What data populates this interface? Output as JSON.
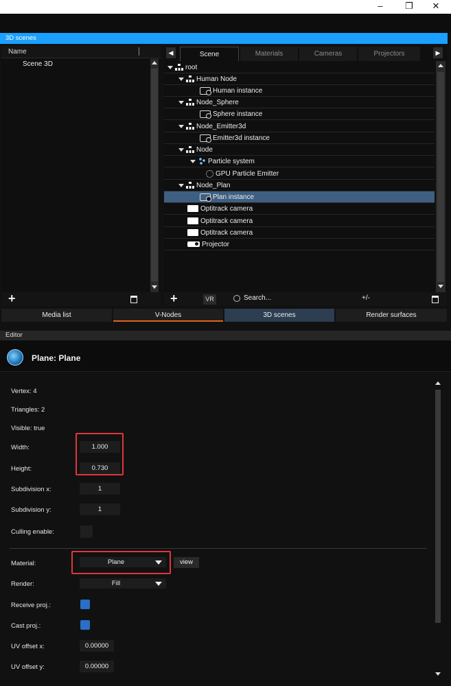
{
  "window": {
    "minimize": "–",
    "restore": "❐",
    "close": "✕"
  },
  "scenes_panel": {
    "title": "3D scenes",
    "name_header": "Name",
    "items": [
      "Scene 3D"
    ]
  },
  "tabs": [
    "Scene",
    "Materials",
    "Cameras",
    "Projectors"
  ],
  "tree": [
    {
      "label": "root",
      "icon": "node-icon"
    },
    {
      "label": "Human Node",
      "icon": "node-icon"
    },
    {
      "label": "Human instance",
      "icon": "instance-icon"
    },
    {
      "label": "Node_Sphere",
      "icon": "node-icon"
    },
    {
      "label": "Sphere instance",
      "icon": "instance-icon"
    },
    {
      "label": "Node_Emitter3d",
      "icon": "node-icon"
    },
    {
      "label": "Emitter3d instance",
      "icon": "instance-icon"
    },
    {
      "label": "Node",
      "icon": "node-icon"
    },
    {
      "label": "Particle system",
      "icon": "particle-icon"
    },
    {
      "label": "GPU Particle Emitter",
      "icon": "gpu-emitter-icon"
    },
    {
      "label": "Node_Plan",
      "icon": "node-icon"
    },
    {
      "label": "Plan instance",
      "icon": "instance-icon"
    },
    {
      "label": "Optitrack camera",
      "icon": "camera-icon"
    },
    {
      "label": "Optitrack camera",
      "icon": "camera-icon"
    },
    {
      "label": "Optitrack camera",
      "icon": "camera-icon"
    },
    {
      "label": "Projector",
      "icon": "projector-icon"
    }
  ],
  "scene_toolbar": {
    "vr": "VR",
    "search": "Search...",
    "plusminus": "+/-"
  },
  "bottom_tabs": [
    "Media list",
    "V-Nodes",
    "3D scenes",
    "Render surfaces"
  ],
  "editor": {
    "bar_title": "Editor",
    "title": "Plane: Plane",
    "vertex": "Vertex: 4",
    "triangles": "Triangles: 2",
    "visible": "Visible: true",
    "width_label": "Width:",
    "width": "1.000",
    "height_label": "Height:",
    "height": "0.730",
    "subx_label": "Subdivision x:",
    "subx": "1",
    "suby_label": "Subdivision y:",
    "suby": "1",
    "culling_label": "Culling enable:",
    "culling": false,
    "material_label": "Material:",
    "material": "Plane",
    "view": "view",
    "render_label": "Render:",
    "render": "Fill",
    "receive_label": "Receive proj.:",
    "receive": true,
    "cast_label": "Cast proj.:",
    "cast": true,
    "uvx_label": "UV offset x:",
    "uvx": "0.00000",
    "uvy_label": "UV offset y:",
    "uvy": "0.00000"
  },
  "colors": {
    "accent": "#1aa0ff",
    "selection": "#3e5f82",
    "highlight_box": "#e0373b",
    "tab_underline": "#e0641f",
    "checkbox": "#2a6fc4"
  }
}
